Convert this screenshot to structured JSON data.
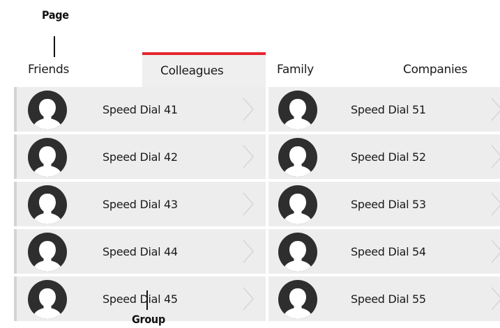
{
  "annotations": {
    "page_label": "Page",
    "group_label": "Group"
  },
  "tabs": [
    {
      "label": "Friends",
      "active": false
    },
    {
      "label": "Colleagues",
      "active": true
    },
    {
      "label": "Family",
      "active": false
    },
    {
      "label": "Companies",
      "active": false
    }
  ],
  "colors": {
    "accent": "#e4262f",
    "cell_bg": "#ededed",
    "avatar_bg": "#2e2e2e"
  },
  "dials": {
    "left": [
      {
        "label": "Speed Dial 41",
        "icon": "contact-avatar-icon"
      },
      {
        "label": "Speed Dial 42",
        "icon": "contact-avatar-icon"
      },
      {
        "label": "Speed Dial 43",
        "icon": "contact-avatar-icon"
      },
      {
        "label": "Speed Dial 44",
        "icon": "contact-avatar-icon"
      },
      {
        "label": "Speed Dial 45",
        "icon": "contact-avatar-icon"
      }
    ],
    "right": [
      {
        "label": "Speed Dial 51",
        "icon": "contact-avatar-icon"
      },
      {
        "label": "Speed Dial 52",
        "icon": "contact-avatar-icon"
      },
      {
        "label": "Speed Dial 53",
        "icon": "contact-avatar-icon"
      },
      {
        "label": "Speed Dial 54",
        "icon": "contact-avatar-icon"
      },
      {
        "label": "Speed Dial 55",
        "icon": "contact-avatar-icon"
      }
    ]
  }
}
